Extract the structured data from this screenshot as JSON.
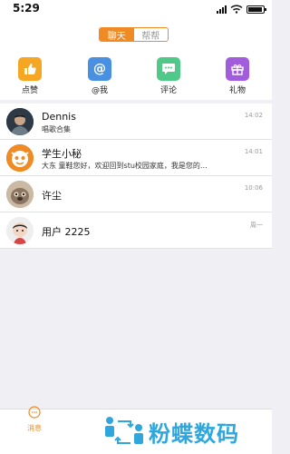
{
  "status": {
    "time": "5:29"
  },
  "segmented": {
    "chat": "聊天",
    "help": "帮帮"
  },
  "quick_actions": [
    {
      "label": "点赞",
      "icon": "thumbs-up-icon",
      "color": "#f5a623"
    },
    {
      "label": "@我",
      "icon": "at-icon",
      "color": "#4a90e2"
    },
    {
      "label": "评论",
      "icon": "comment-icon",
      "color": "#50c889"
    },
    {
      "label": "礼物",
      "icon": "gift-icon",
      "color": "#a25ddc"
    }
  ],
  "conversations": [
    {
      "name": "Dennis",
      "preview": "唱歌合集",
      "time": "14:02"
    },
    {
      "name": "学生小秘",
      "preview": "大东 童鞋您好，欢迎回到stu校园家庭，我是您的…",
      "time": "14:01"
    },
    {
      "name": "许尘",
      "preview": "",
      "time": "10:06"
    },
    {
      "name": "用户 2225",
      "preview": "",
      "time": "周一"
    }
  ],
  "tabbar": {
    "messages": "消息"
  },
  "watermark": {
    "text": "粉蝶数码"
  },
  "colors": {
    "accent": "#f08a24",
    "watermark": "#2fa7dd"
  }
}
